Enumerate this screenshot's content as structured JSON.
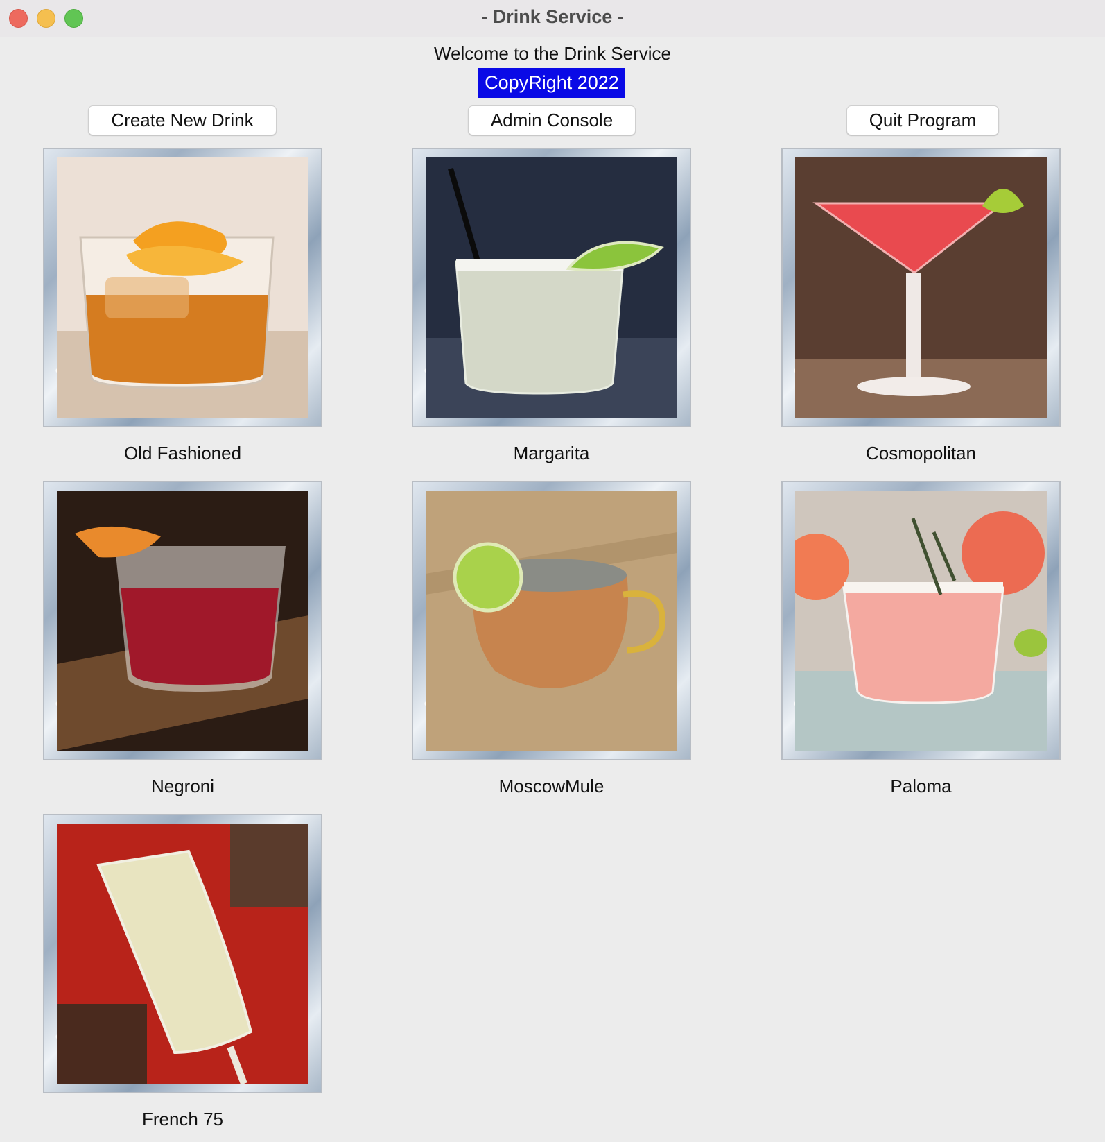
{
  "window": {
    "title": "- Drink Service -"
  },
  "header": {
    "welcome": "Welcome to the Drink Service",
    "copyright": "CopyRight 2022"
  },
  "toolbar": {
    "create_label": "Create New Drink",
    "admin_label": "Admin Console",
    "quit_label": "Quit Program"
  },
  "drinks": [
    {
      "name": "Old Fashioned"
    },
    {
      "name": "Margarita"
    },
    {
      "name": "Cosmopolitan"
    },
    {
      "name": "Negroni"
    },
    {
      "name": "MoscowMule"
    },
    {
      "name": "Paloma"
    },
    {
      "name": "French 75"
    }
  ],
  "colors": {
    "copyright_bg": "#0a0ae6",
    "window_bg": "#ececec",
    "close": "#ed6a5e",
    "minimize": "#f5bf4f",
    "maximize": "#61c554"
  }
}
